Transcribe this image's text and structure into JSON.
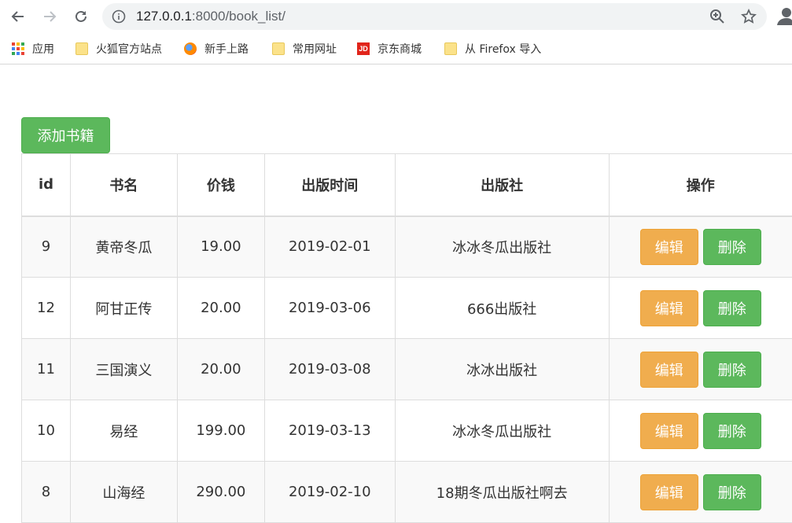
{
  "browser": {
    "url_host": "127.0.0.1",
    "url_rest": ":8000/book_list/"
  },
  "bookmarks": [
    {
      "label": "应用",
      "icon": "apps-grid-icon"
    },
    {
      "label": "火狐官方站点",
      "icon": "folder-icon"
    },
    {
      "label": "新手上路",
      "icon": "firefox-icon"
    },
    {
      "label": "常用网址",
      "icon": "folder-icon"
    },
    {
      "label": "京东商城",
      "icon": "jd-icon",
      "icon_text": "JD"
    },
    {
      "label": "从 Firefox 导入",
      "icon": "folder-icon"
    }
  ],
  "page": {
    "add_label": "添加书籍",
    "columns": [
      "id",
      "书名",
      "价钱",
      "出版时间",
      "出版社",
      "操作"
    ],
    "rows": [
      {
        "id": "9",
        "title": "黄帝冬瓜",
        "price": "19.00",
        "date": "2019-02-01",
        "publisher": "冰冰冬瓜出版社"
      },
      {
        "id": "12",
        "title": "阿甘正传",
        "price": "20.00",
        "date": "2019-03-06",
        "publisher": "666出版社"
      },
      {
        "id": "11",
        "title": "三国演义",
        "price": "20.00",
        "date": "2019-03-08",
        "publisher": "冰冰出版社"
      },
      {
        "id": "10",
        "title": "易经",
        "price": "199.00",
        "date": "2019-03-13",
        "publisher": "冰冰冬瓜出版社"
      },
      {
        "id": "8",
        "title": "山海经",
        "price": "290.00",
        "date": "2019-02-10",
        "publisher": "18期冬瓜出版社啊去"
      }
    ],
    "edit_label": "编辑",
    "delete_label": "删除"
  },
  "colors": {
    "success": "#5cb85c",
    "warning": "#f0ad4e",
    "stripe": "#f9f9f9",
    "border": "#dddddd"
  }
}
